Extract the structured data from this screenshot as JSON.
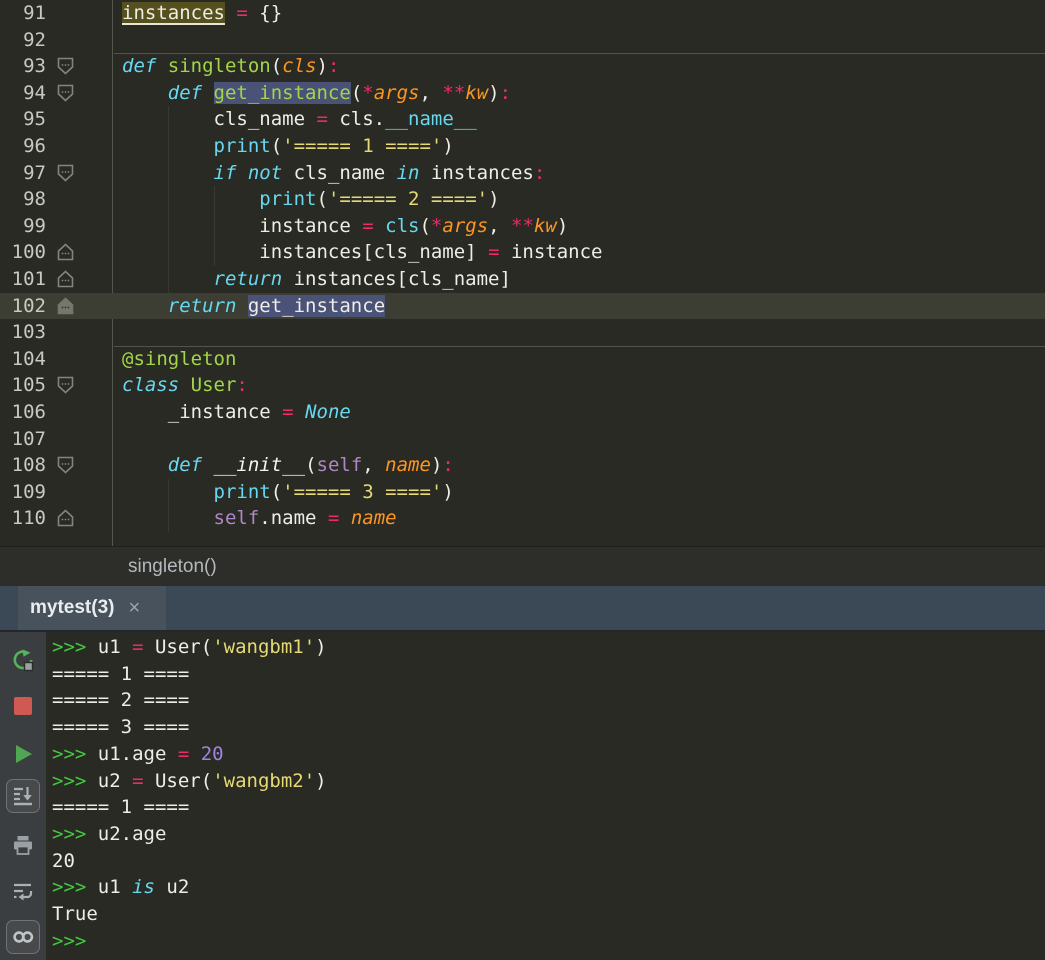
{
  "editor": {
    "lines": [
      {
        "num": "91",
        "indent": 0,
        "marker": null,
        "sep": false,
        "cur": false,
        "tokens": [
          {
            "t": "instances",
            "c": "pln",
            "h": "write"
          },
          {
            "t": " ",
            "c": "pln"
          },
          {
            "t": "=",
            "c": "op"
          },
          {
            "t": " {}",
            "c": "pln"
          }
        ]
      },
      {
        "num": "92",
        "indent": 0,
        "marker": null,
        "sep": false,
        "cur": false,
        "tokens": []
      },
      {
        "num": "93",
        "indent": 0,
        "marker": "down",
        "sep": true,
        "cur": false,
        "tokens": [
          {
            "t": "def",
            "c": "kw"
          },
          {
            "t": " ",
            "c": "pln"
          },
          {
            "t": "singleton",
            "c": "fn"
          },
          {
            "t": "(",
            "c": "pln"
          },
          {
            "t": "cls",
            "c": "arg"
          },
          {
            "t": ")",
            "c": "pln"
          },
          {
            "t": ":",
            "c": "op"
          }
        ]
      },
      {
        "num": "94",
        "indent": 1,
        "marker": "down",
        "sep": false,
        "cur": false,
        "tokens": [
          {
            "t": "def",
            "c": "kw"
          },
          {
            "t": " ",
            "c": "pln"
          },
          {
            "t": "get_instance",
            "c": "fn",
            "h": "sel"
          },
          {
            "t": "(",
            "c": "pln"
          },
          {
            "t": "*",
            "c": "op"
          },
          {
            "t": "args",
            "c": "arg"
          },
          {
            "t": ", ",
            "c": "pln"
          },
          {
            "t": "**",
            "c": "op"
          },
          {
            "t": "kw",
            "c": "arg"
          },
          {
            "t": ")",
            "c": "pln"
          },
          {
            "t": ":",
            "c": "op"
          }
        ]
      },
      {
        "num": "95",
        "indent": 2,
        "marker": null,
        "sep": false,
        "cur": false,
        "tokens": [
          {
            "t": "cls_name ",
            "c": "pln"
          },
          {
            "t": "=",
            "c": "op"
          },
          {
            "t": " cls.",
            "c": "pln"
          },
          {
            "t": "__name__",
            "c": "blt"
          }
        ]
      },
      {
        "num": "96",
        "indent": 2,
        "marker": null,
        "sep": false,
        "cur": false,
        "tokens": [
          {
            "t": "print",
            "c": "blt"
          },
          {
            "t": "(",
            "c": "pln"
          },
          {
            "t": "'===== 1 ===='",
            "c": "str"
          },
          {
            "t": ")",
            "c": "pln"
          }
        ]
      },
      {
        "num": "97",
        "indent": 2,
        "marker": "down",
        "sep": false,
        "cur": false,
        "tokens": [
          {
            "t": "if",
            "c": "kw"
          },
          {
            "t": " ",
            "c": "pln"
          },
          {
            "t": "not",
            "c": "kw"
          },
          {
            "t": " cls_name ",
            "c": "pln"
          },
          {
            "t": "in",
            "c": "kw"
          },
          {
            "t": " instances",
            "c": "pln"
          },
          {
            "t": ":",
            "c": "op"
          }
        ]
      },
      {
        "num": "98",
        "indent": 3,
        "marker": null,
        "sep": false,
        "cur": false,
        "tokens": [
          {
            "t": "print",
            "c": "blt"
          },
          {
            "t": "(",
            "c": "pln"
          },
          {
            "t": "'===== 2 ===='",
            "c": "str"
          },
          {
            "t": ")",
            "c": "pln"
          }
        ]
      },
      {
        "num": "99",
        "indent": 3,
        "marker": null,
        "sep": false,
        "cur": false,
        "tokens": [
          {
            "t": "instance ",
            "c": "pln"
          },
          {
            "t": "=",
            "c": "op"
          },
          {
            "t": " ",
            "c": "pln"
          },
          {
            "t": "cls",
            "c": "blt"
          },
          {
            "t": "(",
            "c": "pln"
          },
          {
            "t": "*",
            "c": "op"
          },
          {
            "t": "args",
            "c": "arg"
          },
          {
            "t": ", ",
            "c": "pln"
          },
          {
            "t": "**",
            "c": "op"
          },
          {
            "t": "kw",
            "c": "arg"
          },
          {
            "t": ")",
            "c": "pln"
          }
        ]
      },
      {
        "num": "100",
        "indent": 3,
        "marker": "up",
        "sep": false,
        "cur": false,
        "tokens": [
          {
            "t": "instances[cls_name] ",
            "c": "pln"
          },
          {
            "t": "=",
            "c": "op"
          },
          {
            "t": " instance",
            "c": "pln"
          }
        ]
      },
      {
        "num": "101",
        "indent": 2,
        "marker": "up",
        "sep": false,
        "cur": false,
        "tokens": [
          {
            "t": "return",
            "c": "kw"
          },
          {
            "t": " instances[cls_name]",
            "c": "pln"
          }
        ]
      },
      {
        "num": "102",
        "indent": 1,
        "marker": "upf",
        "sep": false,
        "cur": true,
        "tokens": [
          {
            "t": "return",
            "c": "kw"
          },
          {
            "t": " ",
            "c": "pln"
          },
          {
            "t": "get_instance",
            "c": "pln",
            "h": "sel"
          }
        ]
      },
      {
        "num": "103",
        "indent": 0,
        "marker": null,
        "sep": false,
        "cur": false,
        "tokens": []
      },
      {
        "num": "104",
        "indent": 0,
        "marker": null,
        "sep": true,
        "cur": false,
        "tokens": [
          {
            "t": "@singleton",
            "c": "dec"
          }
        ]
      },
      {
        "num": "105",
        "indent": 0,
        "marker": "down",
        "sep": false,
        "cur": false,
        "tokens": [
          {
            "t": "class",
            "c": "kw"
          },
          {
            "t": " ",
            "c": "pln"
          },
          {
            "t": "User",
            "c": "fn"
          },
          {
            "t": ":",
            "c": "op"
          }
        ]
      },
      {
        "num": "106",
        "indent": 1,
        "marker": null,
        "sep": false,
        "cur": false,
        "tokens": [
          {
            "t": "_instance ",
            "c": "pln"
          },
          {
            "t": "=",
            "c": "op"
          },
          {
            "t": " ",
            "c": "pln"
          },
          {
            "t": "None",
            "c": "kw"
          }
        ]
      },
      {
        "num": "107",
        "indent": 0,
        "marker": null,
        "sep": false,
        "cur": false,
        "tokens": []
      },
      {
        "num": "108",
        "indent": 1,
        "marker": "down",
        "sep": false,
        "cur": false,
        "tokens": [
          {
            "t": "def",
            "c": "kw"
          },
          {
            "t": " ",
            "c": "pln"
          },
          {
            "t": "__init__",
            "c": "mag"
          },
          {
            "t": "(",
            "c": "pln"
          },
          {
            "t": "self",
            "c": "slf"
          },
          {
            "t": ", ",
            "c": "pln"
          },
          {
            "t": "name",
            "c": "arg"
          },
          {
            "t": ")",
            "c": "pln"
          },
          {
            "t": ":",
            "c": "op"
          }
        ]
      },
      {
        "num": "109",
        "indent": 2,
        "marker": null,
        "sep": false,
        "cur": false,
        "tokens": [
          {
            "t": "print",
            "c": "blt"
          },
          {
            "t": "(",
            "c": "pln"
          },
          {
            "t": "'===== 3 ===='",
            "c": "str"
          },
          {
            "t": ")",
            "c": "pln"
          }
        ]
      },
      {
        "num": "110",
        "indent": 2,
        "marker": "up",
        "sep": false,
        "cur": false,
        "tokens": [
          {
            "t": "self",
            "c": "slf"
          },
          {
            "t": ".name ",
            "c": "pln"
          },
          {
            "t": "=",
            "c": "op"
          },
          {
            "t": " ",
            "c": "pln"
          },
          {
            "t": "name",
            "c": "arg"
          }
        ]
      }
    ]
  },
  "breadcrumb": {
    "label": "singleton()"
  },
  "console": {
    "tab": {
      "label": "mytest(3)",
      "close": "×"
    },
    "toolbar": [
      {
        "name": "rerun-button",
        "icon": "rerun-icon",
        "toggled": false
      },
      {
        "name": "stop-button",
        "icon": "stop-icon",
        "toggled": false
      },
      {
        "name": "execute-button",
        "icon": "play-icon",
        "toggled": false
      },
      {
        "name": "scroll-to-end-toggle",
        "icon": "scroll-to-end-icon",
        "toggled": true
      },
      {
        "name": "print-button",
        "icon": "printer-icon",
        "toggled": false
      },
      {
        "name": "soft-wrap-toggle",
        "icon": "soft-wrap-icon",
        "toggled": false
      },
      {
        "name": "show-variables-toggle",
        "icon": "double-circle-icon",
        "toggled": true
      }
    ],
    "lines": [
      [
        {
          "t": ">>> ",
          "c": "prm"
        },
        {
          "t": "u1 ",
          "c": "pln"
        },
        {
          "t": "= ",
          "c": "op"
        },
        {
          "t": "User(",
          "c": "pln"
        },
        {
          "t": "'wangbm1'",
          "c": "str"
        },
        {
          "t": ")",
          "c": "pln"
        }
      ],
      [
        {
          "t": "===== 1 ====",
          "c": "pln"
        }
      ],
      [
        {
          "t": "===== 2 ====",
          "c": "pln"
        }
      ],
      [
        {
          "t": "===== 3 ====",
          "c": "pln"
        }
      ],
      [
        {
          "t": ">>> ",
          "c": "prm"
        },
        {
          "t": "u1.age ",
          "c": "pln"
        },
        {
          "t": "= ",
          "c": "op"
        },
        {
          "t": "20",
          "c": "num"
        }
      ],
      [
        {
          "t": ">>> ",
          "c": "prm"
        },
        {
          "t": "u2 ",
          "c": "pln"
        },
        {
          "t": "= ",
          "c": "op"
        },
        {
          "t": "User(",
          "c": "pln"
        },
        {
          "t": "'wangbm2'",
          "c": "str"
        },
        {
          "t": ")",
          "c": "pln"
        }
      ],
      [
        {
          "t": "===== 1 ====",
          "c": "pln"
        }
      ],
      [
        {
          "t": ">>> ",
          "c": "prm"
        },
        {
          "t": "u2.age",
          "c": "pln"
        }
      ],
      [
        {
          "t": "20",
          "c": "pln"
        }
      ],
      [
        {
          "t": ">>> ",
          "c": "prm"
        },
        {
          "t": "u1 ",
          "c": "pln"
        },
        {
          "t": "is",
          "c": "kw"
        },
        {
          "t": " u2",
          "c": "pln"
        }
      ],
      [
        {
          "t": "True",
          "c": "pln"
        }
      ],
      [
        {
          "t": ">>>",
          "c": "prm"
        }
      ]
    ]
  }
}
